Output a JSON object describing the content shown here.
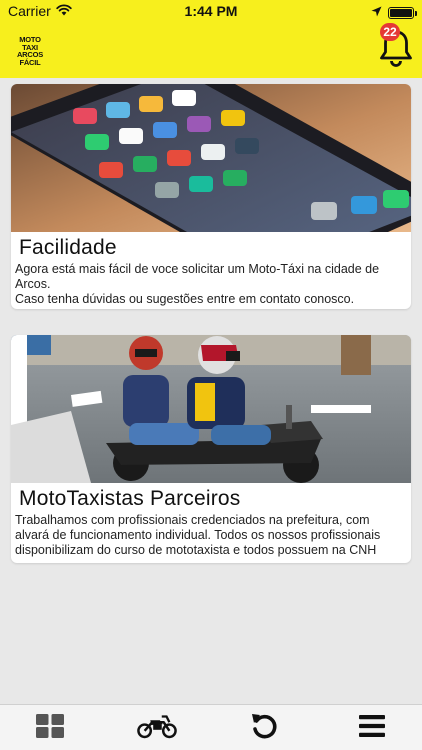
{
  "status_bar": {
    "carrier": "Carrier",
    "time": "1:44 PM"
  },
  "header": {
    "logo_lines": [
      "MOTO TAXI",
      "ARCOS",
      "FÁCIL"
    ],
    "notification_count": "22",
    "background_color": "#f7ef1d"
  },
  "cards": [
    {
      "title": "Facilidade",
      "text_lines": [
        "Agora está mais fácil de voce solicitar um Moto-Táxi na cidade de Arcos.",
        "Caso tenha dúvidas ou sugestões entre em contato conosco."
      ],
      "image": "smartphone-apps-photo"
    },
    {
      "title": "MotoTaxistas Parceiros",
      "text_lines": [
        "Trabalhamos com profissionais credenciados na prefeitura, com alvará de funcionamento individual. Todos os nossos profissionais disponibilizam do curso de mototaxista e todos possuem na CNH"
      ],
      "image": "motorcycle-taxi-photo"
    }
  ],
  "tab_bar": {
    "items": [
      {
        "icon": "grid-icon"
      },
      {
        "icon": "motorcycle-icon"
      },
      {
        "icon": "refresh-icon"
      },
      {
        "icon": "menu-icon"
      }
    ]
  }
}
